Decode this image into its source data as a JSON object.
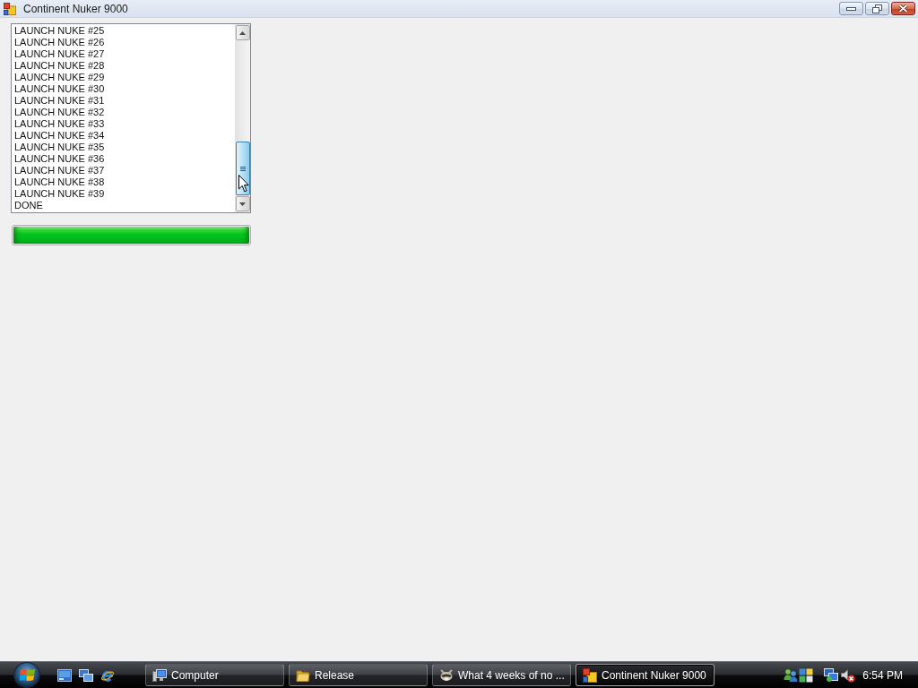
{
  "window": {
    "title": "Continent Nuker 9000"
  },
  "log_list": {
    "items": [
      "LAUNCH NUKE #25",
      "LAUNCH NUKE #26",
      "LAUNCH NUKE #27",
      "LAUNCH NUKE #28",
      "LAUNCH NUKE #29",
      "LAUNCH NUKE #30",
      "LAUNCH NUKE #31",
      "LAUNCH NUKE #32",
      "LAUNCH NUKE #33",
      "LAUNCH NUKE #34",
      "LAUNCH NUKE #35",
      "LAUNCH NUKE #36",
      "LAUNCH NUKE #37",
      "LAUNCH NUKE #38",
      "LAUNCH NUKE #39",
      "DONE"
    ]
  },
  "progress": {
    "level": 1
  },
  "taskbar": {
    "buttons": [
      {
        "kind": "computer",
        "label": "Computer",
        "selected": false
      },
      {
        "kind": "folder",
        "label": "Release",
        "selected": false
      },
      {
        "kind": "animal",
        "label": "What 4 weeks of no ...",
        "selected": false
      },
      {
        "kind": "app",
        "label": "Continent Nuker 9000",
        "selected": true
      }
    ],
    "clock": "6:54 PM"
  }
}
